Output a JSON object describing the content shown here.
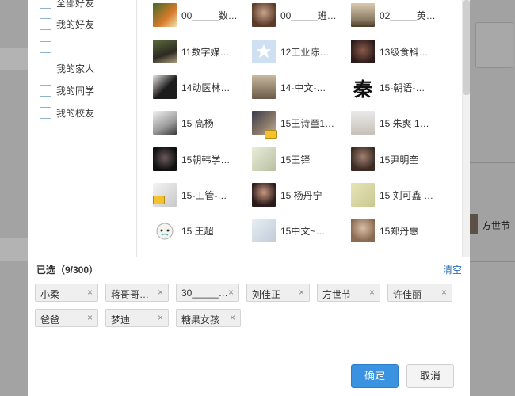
{
  "sidebar": {
    "items": [
      {
        "label": "全部好友"
      },
      {
        "label": "我的好友"
      },
      {
        "label": ""
      },
      {
        "label": "我的家人"
      },
      {
        "label": "我的同学"
      },
      {
        "label": "我的校友"
      }
    ]
  },
  "friends": [
    {
      "name": "00_____数…",
      "avatar": "a1"
    },
    {
      "name": "00_____班…",
      "avatar": "a2"
    },
    {
      "name": "02_____英…",
      "avatar": "a3"
    },
    {
      "name": "11数字媒…",
      "avatar": "a4"
    },
    {
      "name": "12工业陈…",
      "avatar": "star"
    },
    {
      "name": "13级食科…",
      "avatar": "a6"
    },
    {
      "name": "14动医林…",
      "avatar": "a7"
    },
    {
      "name": "14-中文-…",
      "avatar": "a8"
    },
    {
      "name": "15-朝语-…",
      "avatar": "calligraphy",
      "avatar_glyph": "秦"
    },
    {
      "name": "15 高杨",
      "avatar": "a10"
    },
    {
      "name": "15王诗童1…",
      "avatar": "a11",
      "badge": "vip"
    },
    {
      "name": "15 朱爽 1…",
      "avatar": "a12"
    },
    {
      "name": "15朝韩学…",
      "avatar": "a13"
    },
    {
      "name": "15王铎",
      "avatar": "a14"
    },
    {
      "name": "15尹明奎",
      "avatar": "a15"
    },
    {
      "name": "15-工管-…",
      "avatar": "a16",
      "badge": "vip"
    },
    {
      "name": "15 杨丹宁",
      "avatar": "a17"
    },
    {
      "name": "15 刘可鑫 …",
      "avatar": "a18"
    },
    {
      "name": "15 王超",
      "avatar": "cartoon"
    },
    {
      "name": "15中文~…",
      "avatar": "a20"
    },
    {
      "name": "15郑丹惠",
      "avatar": "a21"
    }
  ],
  "selected": {
    "title": "已选（9/300）",
    "clear_label": "清空",
    "chips": [
      {
        "label": "小柔",
        "remove": "×"
      },
      {
        "label": "蒋哥哥…",
        "remove": "×"
      },
      {
        "label": "30_____…",
        "remove": "×"
      },
      {
        "label": "刘佳正",
        "remove": "×"
      },
      {
        "label": "方世节",
        "remove": "×"
      },
      {
        "label": "许佳丽",
        "remove": "×"
      },
      {
        "label": "爸爸",
        "remove": "×"
      },
      {
        "label": "梦迪",
        "remove": "×"
      },
      {
        "label": "糖果女孩",
        "remove": "×"
      }
    ]
  },
  "buttons": {
    "ok": "确定",
    "cancel": "取消"
  },
  "background": {
    "right_name": "方世节"
  },
  "colors": {
    "primary": "#3a92e0",
    "link": "#2a6fb8",
    "overlay": "#9a9a9a"
  }
}
